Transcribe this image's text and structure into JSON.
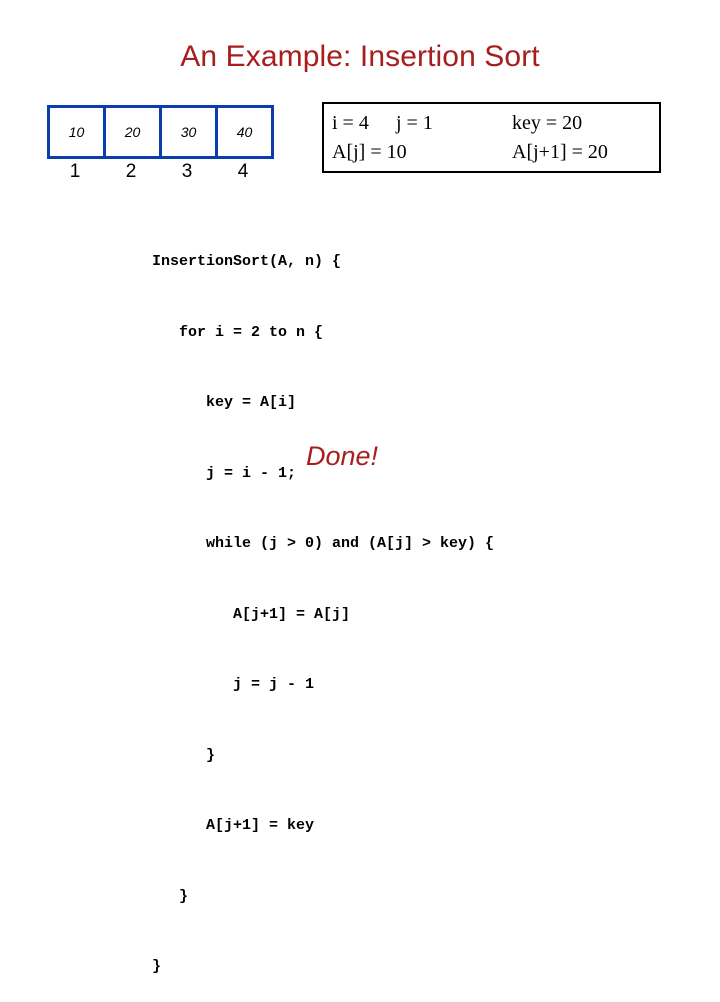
{
  "slide": {
    "title": "An Example: Insertion Sort",
    "title_color": "#a81d1d"
  },
  "array_widget": {
    "border_color": "#0b3dae",
    "values": [
      "10",
      "20",
      "30",
      "40"
    ],
    "indices": [
      "1",
      "2",
      "3",
      "4"
    ]
  },
  "state_box": {
    "border_color": "#000000",
    "line1": {
      "i": "i = 4",
      "j": "j = 1",
      "key": "key = 20"
    },
    "line2": {
      "aj": "A[j] = 10",
      "aj1": "A[j+1] = 20"
    }
  },
  "code": {
    "lines": [
      "InsertionSort(A, n) {",
      "   for i = 2 to n {",
      "      key = A[i]",
      "      j = i - 1;",
      "      while (j > 0) and (A[j] > key) {",
      "         A[j+1] = A[j]",
      "         j = j - 1",
      "      }",
      "      A[j+1] = key",
      "   }",
      "}"
    ]
  },
  "status": {
    "done_label": "Done!",
    "done_color": "#a81d1d"
  }
}
